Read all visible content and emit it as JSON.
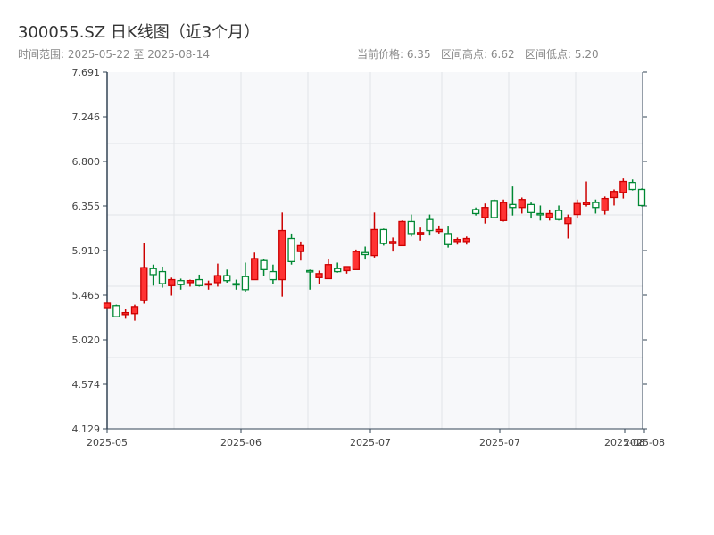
{
  "header": {
    "title": "300055.SZ 日K线图（近3个月）",
    "subtitle": "时间范围: 2025-05-22 至 2025-08-14",
    "stats": "当前价格: 6.35   区间高点: 6.62   区间低点: 5.20"
  },
  "chart_data": {
    "type": "candlestick",
    "title": "300055.SZ 日K线图（近3个月）",
    "ylim": [
      4.129,
      7.691
    ],
    "yticks": [
      "7.691",
      "7.246",
      "6.800",
      "6.355",
      "5.910",
      "5.465",
      "5.020",
      "4.574",
      "4.129"
    ],
    "xticks": [
      "2025-05",
      "2025-06",
      "2025-07",
      "2025-07",
      "2025-08",
      "2025-08"
    ],
    "up_color": "#ff3333",
    "down_color": "#008833",
    "ohlc": [
      [
        5.34,
        5.385,
        5.39,
        5.34
      ],
      [
        5.36,
        5.25,
        5.37,
        5.25
      ],
      [
        5.27,
        5.29,
        5.33,
        5.23
      ],
      [
        5.28,
        5.35,
        5.37,
        5.21
      ],
      [
        5.41,
        5.74,
        5.99,
        5.38
      ],
      [
        5.73,
        5.67,
        5.77,
        5.56
      ],
      [
        5.7,
        5.58,
        5.75,
        5.54
      ],
      [
        5.56,
        5.62,
        5.64,
        5.46
      ],
      [
        5.61,
        5.57,
        5.63,
        5.52
      ],
      [
        5.59,
        5.61,
        5.62,
        5.55
      ],
      [
        5.62,
        5.56,
        5.67,
        5.55
      ],
      [
        5.57,
        5.58,
        5.61,
        5.52
      ],
      [
        5.59,
        5.66,
        5.78,
        5.55
      ],
      [
        5.66,
        5.61,
        5.72,
        5.59
      ],
      [
        5.58,
        5.57,
        5.62,
        5.52
      ],
      [
        5.65,
        5.52,
        5.79,
        5.5
      ],
      [
        5.62,
        5.83,
        5.89,
        5.62
      ],
      [
        5.81,
        5.72,
        5.83,
        5.66
      ],
      [
        5.7,
        5.62,
        5.77,
        5.58
      ],
      [
        5.62,
        6.11,
        6.29,
        5.45
      ],
      [
        6.03,
        5.8,
        6.08,
        5.77
      ],
      [
        5.9,
        5.96,
        6.0,
        5.81
      ],
      [
        5.71,
        5.7,
        5.72,
        5.52
      ],
      [
        5.64,
        5.68,
        5.71,
        5.58
      ],
      [
        5.63,
        5.77,
        5.83,
        5.63
      ],
      [
        5.73,
        5.7,
        5.79,
        5.69
      ],
      [
        5.71,
        5.75,
        5.75,
        5.68
      ],
      [
        5.72,
        5.9,
        5.92,
        5.72
      ],
      [
        5.89,
        5.87,
        5.95,
        5.82
      ],
      [
        5.86,
        6.12,
        6.29,
        5.84
      ],
      [
        6.12,
        5.98,
        6.13,
        5.96
      ],
      [
        5.98,
        6.0,
        6.04,
        5.9
      ],
      [
        5.96,
        6.2,
        6.21,
        5.96
      ],
      [
        6.2,
        6.08,
        6.27,
        6.05
      ],
      [
        6.08,
        6.09,
        6.14,
        6.01
      ],
      [
        6.22,
        6.11,
        6.27,
        6.06
      ],
      [
        6.1,
        6.12,
        6.16,
        6.08
      ],
      [
        6.08,
        5.97,
        6.15,
        5.94
      ],
      [
        6.0,
        6.02,
        6.04,
        5.97
      ],
      [
        6.0,
        6.03,
        6.05,
        5.97
      ],
      [
        6.32,
        6.28,
        6.34,
        6.26
      ],
      [
        6.24,
        6.34,
        6.38,
        6.18
      ],
      [
        6.41,
        6.24,
        6.42,
        6.24
      ],
      [
        6.21,
        6.39,
        6.42,
        6.2
      ],
      [
        6.37,
        6.34,
        6.55,
        6.26
      ],
      [
        6.34,
        6.42,
        6.44,
        6.28
      ],
      [
        6.37,
        6.29,
        6.39,
        6.23
      ],
      [
        6.28,
        6.27,
        6.36,
        6.21
      ],
      [
        6.24,
        6.28,
        6.32,
        6.21
      ],
      [
        6.31,
        6.22,
        6.36,
        6.21
      ],
      [
        6.18,
        6.24,
        6.27,
        6.03
      ],
      [
        6.27,
        6.38,
        6.42,
        6.23
      ],
      [
        6.37,
        6.39,
        6.6,
        6.35
      ],
      [
        6.39,
        6.34,
        6.42,
        6.28
      ],
      [
        6.31,
        6.43,
        6.45,
        6.27
      ],
      [
        6.44,
        6.5,
        6.52,
        6.36
      ],
      [
        6.49,
        6.6,
        6.63,
        6.43
      ],
      [
        6.59,
        6.52,
        6.62,
        6.51
      ],
      [
        6.52,
        6.36,
        6.53,
        6.35
      ]
    ]
  }
}
